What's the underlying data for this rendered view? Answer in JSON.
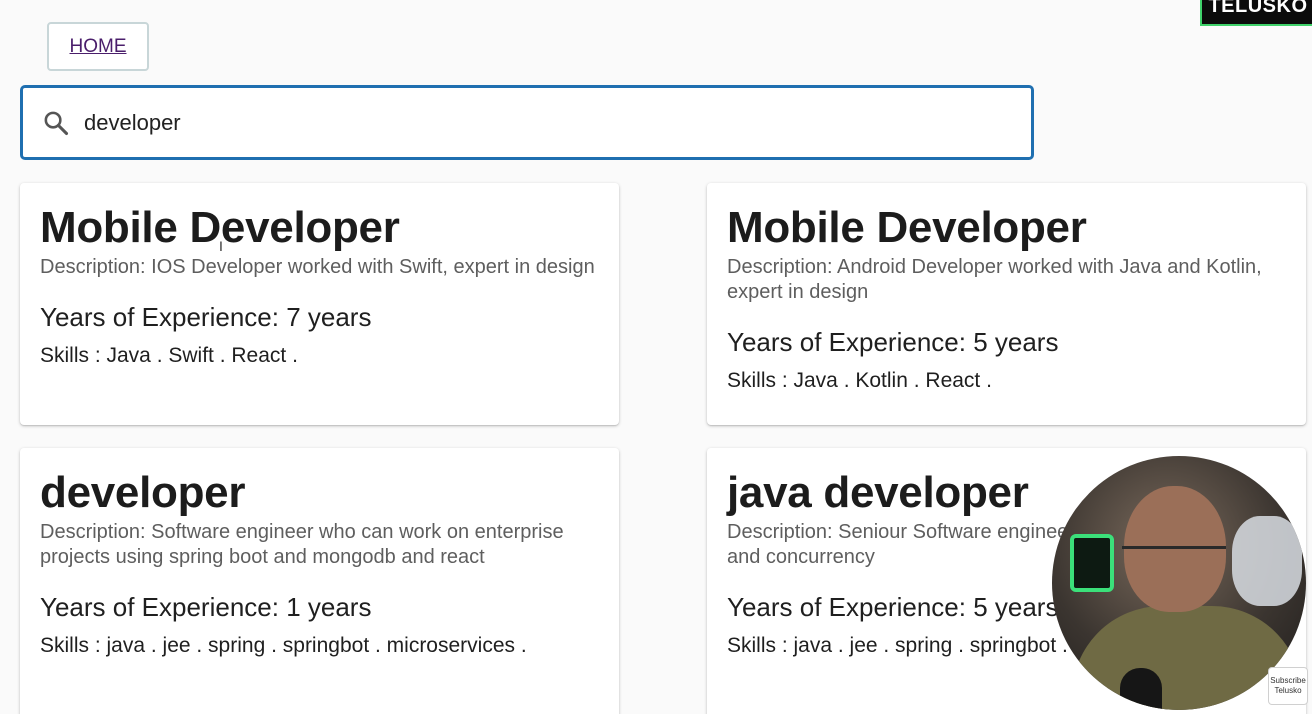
{
  "brand": {
    "logo_text": "TELUSKO"
  },
  "nav": {
    "home_label": "HOME"
  },
  "search": {
    "value": "developer",
    "icon": "search-icon"
  },
  "cards": [
    {
      "title": "Mobile Developer",
      "description": "Description: IOS Developer worked with Swift, expert in design",
      "experience": "Years of Experience: 7 years",
      "skills": "Skills : Java . Swift . React ."
    },
    {
      "title": "Mobile Developer",
      "description": "Description: Android Developer worked with Java and Kotlin, expert in design",
      "experience": "Years of Experience: 5 years",
      "skills": "Skills : Java . Kotlin . React ."
    },
    {
      "title": "developer",
      "description": "Description: Software engineer who can work on enterprise projects using spring boot and mongodb and react",
      "experience": "Years of Experience: 1 years",
      "skills": "Skills : java . jee . spring . springbot . microservices ."
    },
    {
      "title": "java developer",
      "description": "Description: Seniour Software engineer, expert in core java and concurrency",
      "experience": "Years of Experience: 5 years",
      "skills": "Skills : java . jee . spring . springbot . threads ."
    }
  ],
  "overlay": {
    "subscribe_label": "Subscribe",
    "channel_label": "Telusko"
  },
  "colors": {
    "search_border": "#1f6fb0",
    "logo_accent": "#3fd16a",
    "link": "#4a1e6b"
  }
}
